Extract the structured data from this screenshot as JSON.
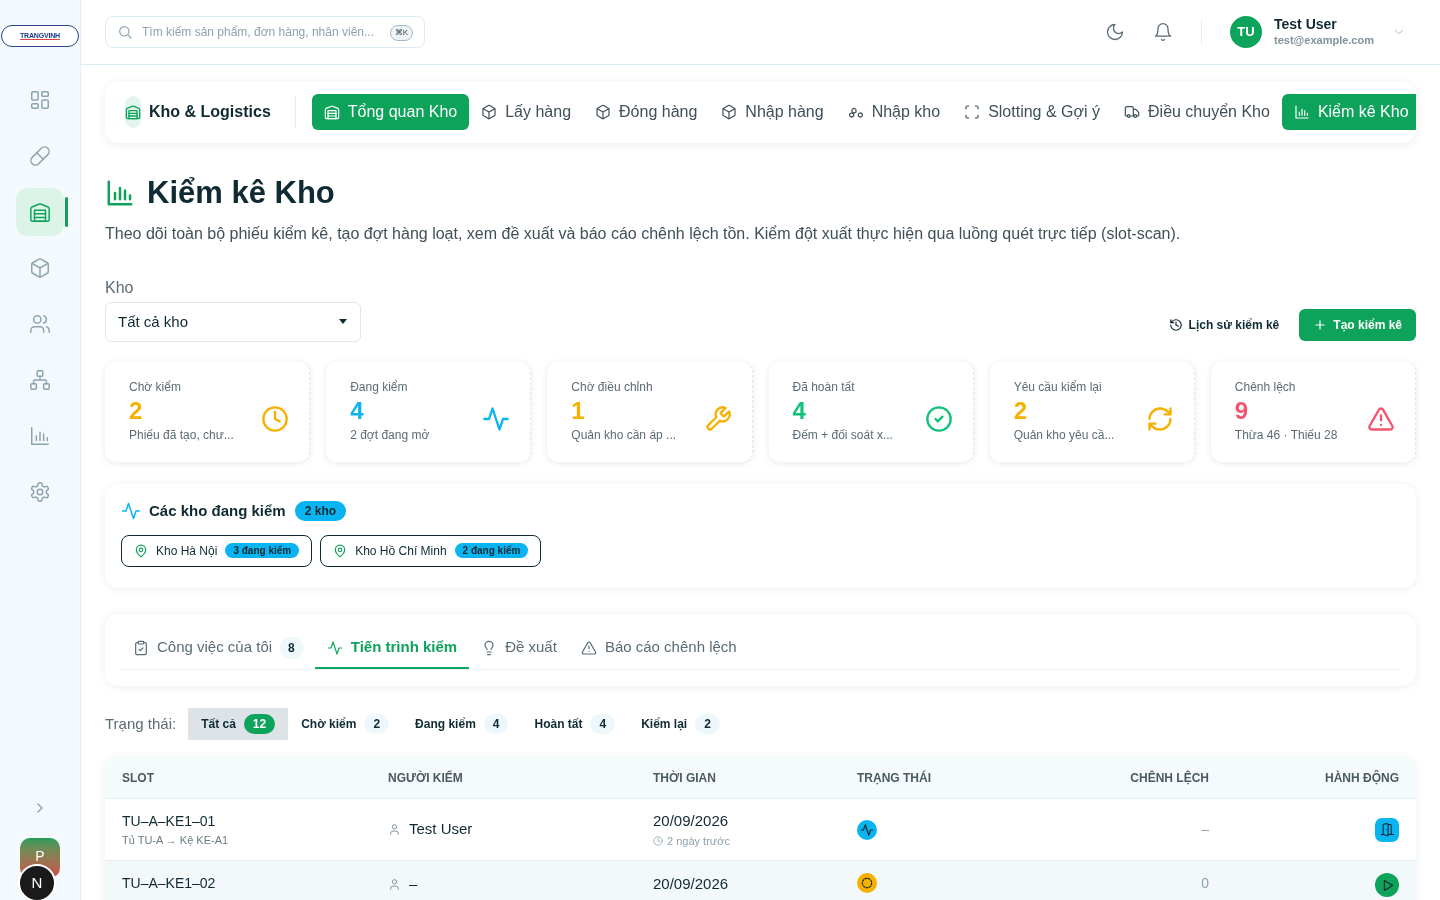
{
  "logo": {
    "text": "TRANGVINH"
  },
  "search": {
    "placeholder": "Tìm kiếm sản phẩm, đơn hàng, nhân viên...",
    "shortcut": "⌘K"
  },
  "user": {
    "initials": "TU",
    "name": "Test User",
    "email": "test@example.com"
  },
  "sidebar": {
    "items": [
      {
        "selected": false
      },
      {
        "selected": false
      },
      {
        "selected": true
      },
      {
        "selected": false
      },
      {
        "selected": false
      },
      {
        "selected": false
      },
      {
        "selected": false
      },
      {
        "selected": false
      }
    ],
    "avatars": [
      "P",
      "N"
    ]
  },
  "module": {
    "title": "Kho & Logistics",
    "tabs": [
      {
        "label": "Tổng quan Kho",
        "selected": true
      },
      {
        "label": "Lấy hàng",
        "selected": false
      },
      {
        "label": "Đóng hàng",
        "selected": false
      },
      {
        "label": "Nhập hàng",
        "selected": false
      },
      {
        "label": "Nhập kho",
        "selected": false
      },
      {
        "label": "Slotting & Gợi ý",
        "selected": false
      },
      {
        "label": "Điều chuyển Kho",
        "selected": false
      },
      {
        "label": "Kiểm kê Kho",
        "selected": true
      }
    ]
  },
  "page": {
    "title": "Kiểm kê Kho",
    "description": "Theo dõi toàn bộ phiếu kiểm kê, tạo đợt hàng loạt, xem đề xuất và báo cáo chênh lệch tồn. Kiểm đột xuất thực hiện qua luồng quét trực tiếp (slot-scan)."
  },
  "warehouse_filter": {
    "label": "Kho",
    "value": "Tất cả kho"
  },
  "actions": {
    "history": "Lịch sử kiểm kê",
    "create": "Tạo kiểm kê"
  },
  "stats": [
    {
      "label": "Chờ kiểm",
      "value": "2",
      "note": "Phiếu đã tạo, chư...",
      "color": "#f5b000"
    },
    {
      "label": "Đang kiểm",
      "value": "4",
      "note": "2 đợt đang mở",
      "color": "#0ab4f0"
    },
    {
      "label": "Chờ điều chỉnh",
      "value": "1",
      "note": "Quản kho cần áp ...",
      "color": "#f5b000"
    },
    {
      "label": "Đã hoàn tất",
      "value": "4",
      "note": "Đếm + đối soát x...",
      "color": "#10c27a"
    },
    {
      "label": "Yêu cầu kiểm lại",
      "value": "2",
      "note": "Quản kho yêu cầ...",
      "color": "#f5b000"
    },
    {
      "label": "Chênh lệch",
      "value": "9",
      "note": "Thừa 46 · Thiếu 28",
      "color": "#f2566e"
    }
  ],
  "active_warehouses": {
    "title": "Các kho đang kiểm",
    "badge": "2 kho",
    "items": [
      {
        "name": "Kho Hà Nội",
        "badge": "3 đang kiểm"
      },
      {
        "name": "Kho Hồ Chí Minh",
        "badge": "2 đang kiểm"
      }
    ]
  },
  "view_tabs": [
    {
      "label": "Công việc của tôi",
      "count": "8",
      "selected": false
    },
    {
      "label": "Tiến trình kiểm",
      "selected": true
    },
    {
      "label": "Đề xuất",
      "selected": false
    },
    {
      "label": "Báo cáo chênh lệch",
      "selected": false
    }
  ],
  "status_filter": {
    "label": "Trạng thái:",
    "chips": [
      {
        "label": "Tất cả",
        "count": "12",
        "selected": true
      },
      {
        "label": "Chờ kiểm",
        "count": "2",
        "selected": false
      },
      {
        "label": "Đang kiểm",
        "count": "4",
        "selected": false
      },
      {
        "label": "Hoàn tất",
        "count": "4",
        "selected": false
      },
      {
        "label": "Kiểm lại",
        "count": "2",
        "selected": false
      }
    ]
  },
  "table": {
    "columns": [
      "SLOT",
      "NGƯỜI KIỂM",
      "THỜI GIAN",
      "TRẠNG THÁI",
      "CHÊNH LỆCH",
      "HÀNH ĐỘNG"
    ],
    "rows": [
      {
        "slot": "TU–A–KE1–01",
        "location": "Tủ TU-A → Kệ KE-A1",
        "counter": "Test User",
        "date": "20/09/2026",
        "ago": "2 ngày trước",
        "status": {
          "kind": "counting"
        },
        "diff": "–",
        "action": {
          "kind": "open"
        }
      },
      {
        "slot": "TU–A–KE1–02",
        "counter": "–",
        "date": "20/09/2026",
        "status": {
          "kind": "pending"
        },
        "diff": "0",
        "action": {
          "kind": "start"
        }
      }
    ]
  }
}
